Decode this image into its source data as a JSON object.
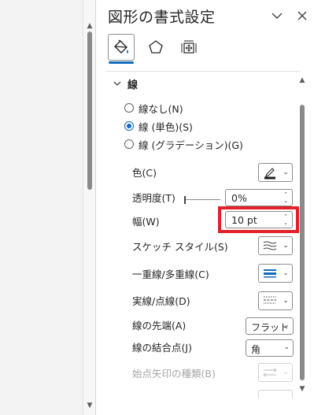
{
  "pane": {
    "title": "図形の書式設定",
    "tabs": [
      {
        "name": "塗りつぶしと線",
        "icon": "paint-bucket-icon",
        "selected": true
      },
      {
        "name": "効果",
        "icon": "pentagon-icon",
        "selected": false
      },
      {
        "name": "サイズとプロパティ",
        "icon": "size-properties-icon",
        "selected": false
      }
    ],
    "section_title": "線",
    "radios": [
      {
        "label": "線なし(N)",
        "selected": false
      },
      {
        "label": "線 (単色)(S)",
        "selected": true
      },
      {
        "label": "線 (グラデーション)(G)",
        "selected": false
      }
    ],
    "props": {
      "color_label": "色(C)",
      "transparency_label": "透明度(T)",
      "transparency_value": "0%",
      "width_label": "幅(W)",
      "width_value": "10 pt",
      "sketch_label": "スケッチ スタイル(S)",
      "compound_label": "一重線/多重線(C)",
      "dash_label": "実線/点線(D)",
      "cap_label": "線の先端(A)",
      "cap_value": "フラット",
      "join_label": "線の結合点(J)",
      "join_value": "角",
      "begin_arrow_label": "始点矢印の種類(B)"
    },
    "colors": {
      "accent": "#0f6cbd",
      "highlight": "#e32228",
      "line_color": "#1f1f1f"
    }
  }
}
